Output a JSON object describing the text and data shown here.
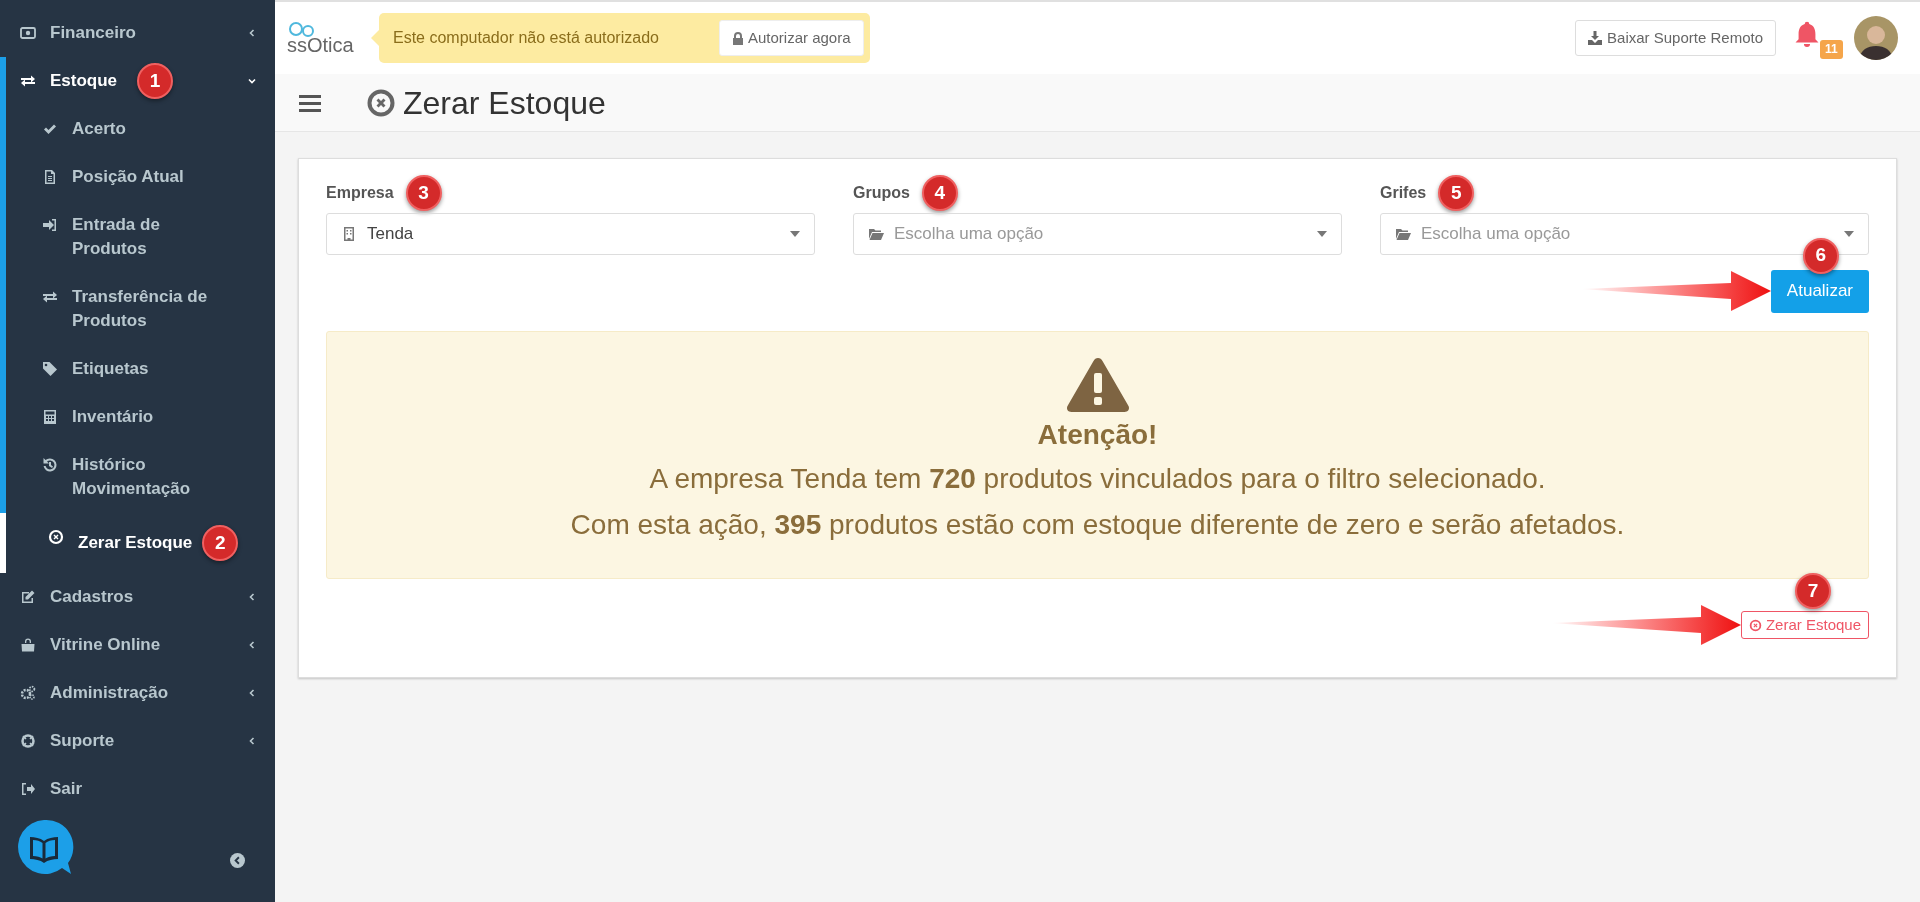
{
  "sidebar": {
    "items": [
      {
        "label": "Financeiro",
        "kind": "money",
        "expanded": false,
        "selected": false,
        "has_submenu": true
      },
      {
        "label": "Estoque",
        "kind": "exchange",
        "expanded": true,
        "selected": true,
        "has_submenu": true,
        "badge": "1",
        "children": [
          {
            "label": "Acerto",
            "kind": "check",
            "selected": false
          },
          {
            "label": "Posição Atual",
            "kind": "file",
            "selected": false
          },
          {
            "label": "Entrada de Produtos",
            "kind": "signin",
            "selected": false
          },
          {
            "label": "Transferência de Produtos",
            "kind": "exchange",
            "selected": false
          },
          {
            "label": "Etiquetas",
            "kind": "tag",
            "selected": false
          },
          {
            "label": "Inventário",
            "kind": "calculator",
            "selected": false
          },
          {
            "label": "Histórico Movimentação",
            "kind": "history",
            "selected": false
          },
          {
            "label": "Zerar Estoque",
            "kind": "xcircle",
            "selected": true,
            "badge": "2"
          }
        ]
      },
      {
        "label": "Cadastros",
        "kind": "edit",
        "expanded": false,
        "selected": false,
        "has_submenu": true
      },
      {
        "label": "Vitrine Online",
        "kind": "bag",
        "expanded": false,
        "selected": false,
        "has_submenu": true
      },
      {
        "label": "Administração",
        "kind": "cogs",
        "expanded": false,
        "selected": false,
        "has_submenu": true
      },
      {
        "label": "Suporte",
        "kind": "lifering",
        "expanded": false,
        "selected": false,
        "has_submenu": true
      },
      {
        "label": "Sair",
        "kind": "signout",
        "expanded": false,
        "selected": false,
        "has_submenu": false
      }
    ]
  },
  "header": {
    "logo": "ssOtica",
    "auth_notice": "Este computador não está autorizado",
    "auth_button": "Autorizar agora",
    "remote_button": "Baixar Suporte Remoto",
    "notifications": "11"
  },
  "page_title": "Zerar Estoque",
  "filters": [
    {
      "label": "Empresa",
      "kind": "building",
      "value": "Tenda",
      "badge": "3"
    },
    {
      "label": "Grupos",
      "kind": "folder",
      "placeholder": "Escolha uma opção",
      "badge": "4"
    },
    {
      "label": "Grifes",
      "kind": "folder",
      "placeholder": "Escolha uma opção",
      "badge": "5"
    }
  ],
  "update_button": {
    "label": "Atualizar",
    "badge": "6",
    "arrow": true
  },
  "alert": {
    "title": "Atenção!",
    "lines": [
      "A empresa Tenda tem **720** produtos vinculados para o filtro selecionado.",
      "Com esta ação, **395** produtos estão com estoque diferente de zero e serão afetados."
    ]
  },
  "reset_button": {
    "label": "Zerar Estoque",
    "badge": "7",
    "arrow": true
  }
}
